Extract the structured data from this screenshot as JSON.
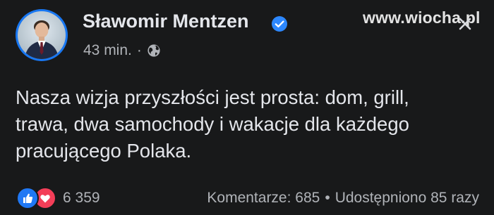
{
  "post": {
    "author": "Sławomir Mentzen",
    "time": "43 min.",
    "separator": "·",
    "text_lines": [
      "Nasza wizja przyszłości jest prosta: dom, grill,",
      "trawa, dwa samochody i wakacje dla każdego",
      "pracującego Polaka."
    ],
    "reactions_count": "6 359",
    "comments": "Komentarze: 685",
    "shares": "Udostępniono 85 razy",
    "dot": "•"
  },
  "watermark": "www.wiocha.pl",
  "icons": {
    "verified": "verified-badge-icon",
    "privacy": "globe-icon",
    "like": "like-icon",
    "love": "love-icon"
  },
  "colors": {
    "background": "#18191a",
    "text": "#e4e6eb",
    "secondary": "#b0b3b8",
    "accent": "#2078f4",
    "love": "#f33e58"
  }
}
